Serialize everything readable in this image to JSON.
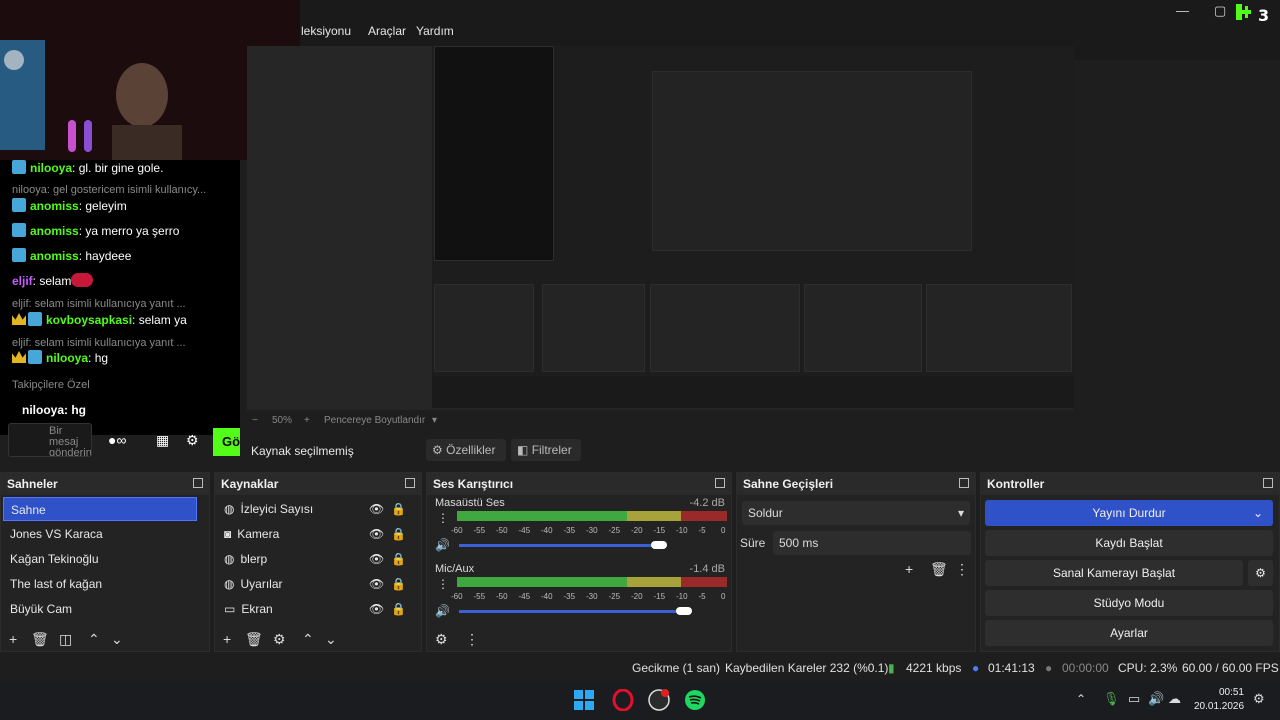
{
  "menu": {
    "items": [
      "leksiyonu",
      "Araçlar",
      "Yardım"
    ]
  },
  "window": {
    "minimize": "—",
    "maximize": "▢",
    "close": "✕"
  },
  "kick_badge": "K3",
  "chat": {
    "lines": [
      {
        "type": "msg",
        "user": "nilooya",
        "text": "gl. bir gine gole."
      },
      {
        "type": "sys",
        "text": "nilooya: gel gostericem isimli kullanıcy..."
      },
      {
        "type": "msg",
        "user": "anomiss",
        "text": "geleyim"
      },
      {
        "type": "msg",
        "user": "anomiss",
        "text": "ya merro ya şerro"
      },
      {
        "type": "msg",
        "user": "anomiss",
        "text": "haydeee"
      },
      {
        "type": "msg",
        "user": "eljif",
        "text": "selam"
      },
      {
        "type": "sys",
        "text": "eljif: selam isimli kullanıcıya yanıt ..."
      },
      {
        "type": "msg",
        "user": "kovboysapkasi",
        "text": "selam ya"
      },
      {
        "type": "sys",
        "text": "eljif: selam isimli kullanıcıya yanıt ..."
      },
      {
        "type": "msg",
        "user": "nilooya",
        "text": "hg"
      }
    ],
    "followers_label": "Takipçilere Özel",
    "bottom_line": "nilooya: hg",
    "send_placeholder": "Bir mesaj gönderin",
    "go_label": "Gö"
  },
  "zoom": {
    "percent": "50%",
    "fit_label": "Pencereye Boyutlandır"
  },
  "sourcebar": {
    "label": "Kaynak seçilmemiş",
    "properties": "Özellikler",
    "filters": "Filtreler"
  },
  "scenes": {
    "title": "Sahneler",
    "items": [
      "Sahne",
      "Jones VS Karaca",
      "Kağan Tekinoğlu",
      "The last of kağan",
      "Büyük Cam"
    ],
    "selected": 0
  },
  "sources": {
    "title": "Kaynaklar",
    "items": [
      {
        "label": "İzleyici Sayısı",
        "icon": "browser-icon"
      },
      {
        "label": "Kamera",
        "icon": "camera-icon"
      },
      {
        "label": "blerp",
        "icon": "browser-icon"
      },
      {
        "label": "Uyarılar",
        "icon": "browser-icon"
      },
      {
        "label": "Ekran",
        "icon": "monitor-icon"
      }
    ]
  },
  "mixer": {
    "title": "Ses Karıştırıcı",
    "channels": [
      {
        "name": "Masaüstü Ses",
        "db": "-4.2 dB",
        "volume": 0.8
      },
      {
        "name": "Mic/Aux",
        "db": "-1.4 dB",
        "volume": 0.9
      }
    ],
    "scale": [
      "-60",
      "-55",
      "-50",
      "-45",
      "-40",
      "-35",
      "-30",
      "-25",
      "-20",
      "-15",
      "-10",
      "-5",
      "0"
    ]
  },
  "transitions": {
    "title": "Sahne Geçişleri",
    "selected": "Soldur",
    "duration_label": "Süre",
    "duration_value": "500 ms"
  },
  "controls": {
    "title": "Kontroller",
    "stop_stream": "Yayını Durdur",
    "start_record": "Kaydı Başlat",
    "virtual_cam": "Sanal Kamerayı Başlat",
    "studio_mode": "Stüdyo Modu",
    "settings": "Ayarlar"
  },
  "status": {
    "delay": "Gecikme (1 san)",
    "dropped": "Kaybedilen Kareler 232 (%0.1)",
    "bitrate": "4221 kbps",
    "stream_time": "01:41:13",
    "record_time": "00:00:00",
    "cpu": "CPU: 2.3%",
    "fps": "60.00 / 60.00 FPS"
  },
  "taskbar": {
    "time": "00:51",
    "date": "20.01.2026"
  },
  "colors": {
    "accent": "#2f52c9",
    "kick_green": "#53fc18",
    "meter_green": "#3fa93f",
    "meter_yellow": "#a7a23a",
    "meter_red": "#9a2a2a"
  }
}
